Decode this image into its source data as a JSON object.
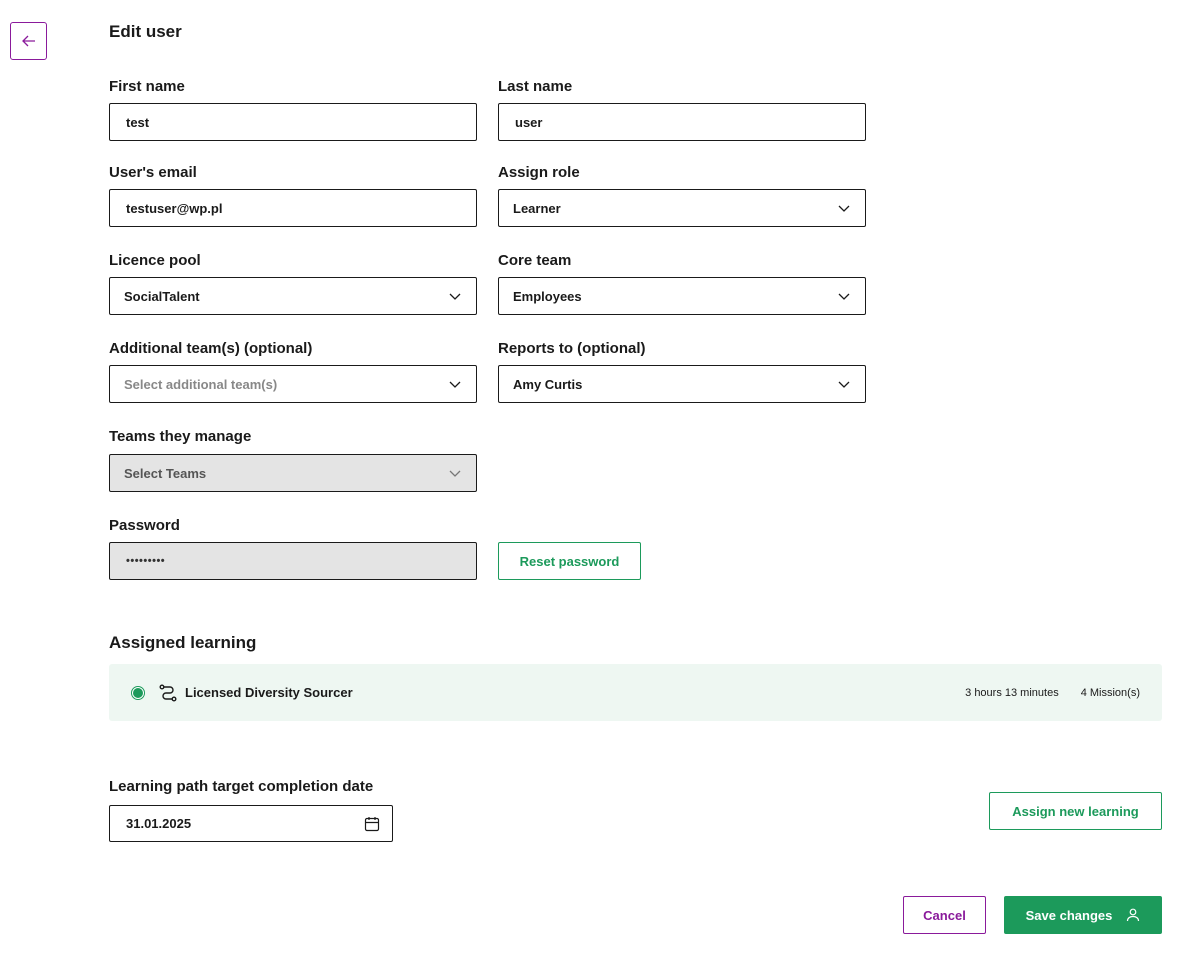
{
  "page": {
    "title": "Edit user"
  },
  "form": {
    "first_name": {
      "label": "First name",
      "value": "test"
    },
    "last_name": {
      "label": "Last name",
      "value": "user"
    },
    "email": {
      "label": "User's email",
      "value": "testuser@wp.pl"
    },
    "role": {
      "label": "Assign role",
      "value": "Learner"
    },
    "licence_pool": {
      "label": "Licence pool",
      "value": "SocialTalent"
    },
    "core_team": {
      "label": "Core team",
      "value": "Employees"
    },
    "additional_teams": {
      "label": "Additional team(s) (optional)",
      "placeholder": "Select additional team(s)"
    },
    "reports_to": {
      "label": "Reports to (optional)",
      "value": "Amy Curtis"
    },
    "teams_manage": {
      "label": "Teams they manage",
      "placeholder": "Select Teams"
    },
    "password": {
      "label": "Password",
      "value": "•••••••••"
    },
    "reset_password_label": "Reset password"
  },
  "assigned_learning": {
    "title": "Assigned learning",
    "items": [
      {
        "name": "Licensed Diversity Sourcer",
        "duration": "3 hours 13 minutes",
        "missions": "4 Mission(s)"
      }
    ]
  },
  "completion": {
    "label": "Learning path target completion date",
    "date": "31.01.2025",
    "assign_new_label": "Assign new learning"
  },
  "actions": {
    "cancel": "Cancel",
    "save": "Save changes"
  },
  "colors": {
    "accent_purple": "#8a1a9b",
    "accent_green": "#1c9a5b",
    "learning_bg": "#eef7f2"
  }
}
